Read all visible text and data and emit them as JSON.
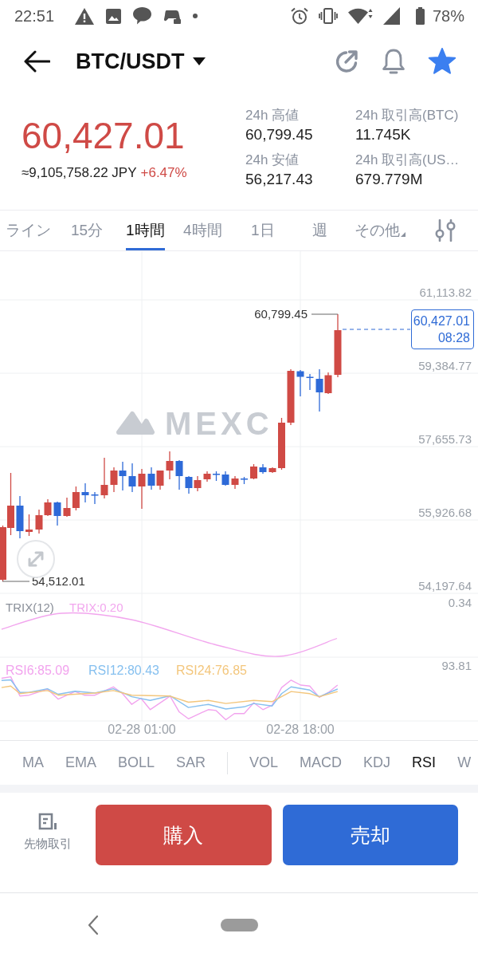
{
  "status_bar": {
    "time": "22:51",
    "battery": "78%"
  },
  "header": {
    "title": "BTC/USDT",
    "favorite": true
  },
  "ticker": {
    "price": "60,427.01",
    "converted": "≈9,105,758.22 JPY",
    "change": "+6.47%",
    "stats": [
      {
        "label": "24h 高値",
        "value": "60,799.45"
      },
      {
        "label": "24h 取引高(BTC)",
        "value": "11.745K"
      },
      {
        "label": "24h 安値",
        "value": "56,217.43"
      },
      {
        "label": "24h 取引高(US…",
        "value": "679.779M"
      }
    ]
  },
  "intervals": [
    {
      "label": "ライン",
      "selected": false,
      "kind": "interval"
    },
    {
      "label": "15分",
      "selected": false,
      "kind": "interval"
    },
    {
      "label": "1時間",
      "selected": true,
      "kind": "interval"
    },
    {
      "label": "4時間",
      "selected": false,
      "kind": "interval"
    },
    {
      "label": "1日",
      "selected": false,
      "kind": "interval"
    },
    {
      "label": "週",
      "selected": false,
      "kind": "interval"
    },
    {
      "label": "その他",
      "selected": false,
      "kind": "menu"
    }
  ],
  "chart": {
    "watermark": "MEXC",
    "y_ticks": [
      "61,113.82",
      "59,384.77",
      "57,655.73",
      "55,926.68",
      "54,197.64"
    ],
    "high_label": "60,799.45",
    "low_label": "54,512.01",
    "last_price": "60,427.01",
    "last_time": "08:28",
    "trix": {
      "title": "TRIX(12)",
      "value": "TRIX:0.20",
      "scale": "0.34"
    },
    "rsi": {
      "series": [
        {
          "label": "RSI6:85.09",
          "color": "#f2a3ee"
        },
        {
          "label": "RSI12:80.43",
          "color": "#86c0ef"
        },
        {
          "label": "RSI24:76.85",
          "color": "#f3c67c"
        }
      ],
      "scale": "93.81"
    },
    "time_labels": [
      "02-28 01:00",
      "02-28 18:00"
    ]
  },
  "main_indicators": [
    {
      "label": "MA",
      "selected": false
    },
    {
      "label": "EMA",
      "selected": false
    },
    {
      "label": "BOLL",
      "selected": false
    },
    {
      "label": "SAR",
      "selected": false
    }
  ],
  "sub_indicators": [
    {
      "label": "VOL",
      "selected": false
    },
    {
      "label": "MACD",
      "selected": false
    },
    {
      "label": "KDJ",
      "selected": false
    },
    {
      "label": "RSI",
      "selected": true
    },
    {
      "label": "W",
      "selected": false
    }
  ],
  "actions": {
    "futures": "先物取引",
    "buy": "購入",
    "sell": "売却"
  }
}
